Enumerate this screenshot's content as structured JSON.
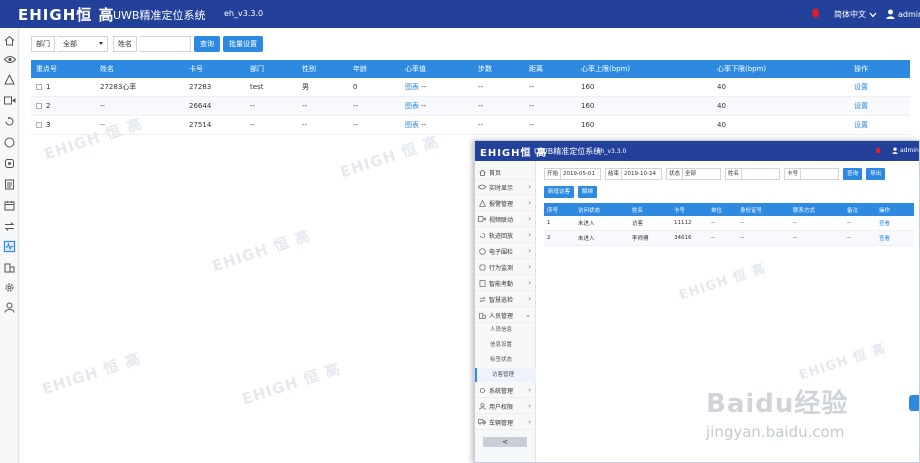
{
  "header": {
    "logo": "EHIGH恒 高",
    "title": "UWB精准定位系统",
    "version": "eh_v3.3.0",
    "language": "简体中文",
    "username": "admin"
  },
  "filters": {
    "dept_label": "部门",
    "dept_value": "全部",
    "name_label": "姓名",
    "name_value": "",
    "query_button": "查询",
    "batch_button": "批量设置"
  },
  "table": {
    "headers": [
      "重点号",
      "姓名",
      "卡号",
      "部门",
      "性别",
      "年龄",
      "心率值",
      "步数",
      "距离",
      "心率上限(bpm)",
      "心率下限(bpm)",
      "操作"
    ],
    "rows": [
      {
        "no": "1",
        "name": "27283心率",
        "card": "27283",
        "dept": "test",
        "sex": "男",
        "age": "0",
        "hr_link": "图表",
        "hr": "--",
        "steps": "--",
        "dist": "--",
        "upper": "160",
        "lower": "40",
        "action": "设置"
      },
      {
        "no": "2",
        "name": "--",
        "card": "26644",
        "dept": "--",
        "sex": "--",
        "age": "--",
        "hr_link": "图表",
        "hr": "--",
        "steps": "--",
        "dist": "--",
        "upper": "160",
        "lower": "40",
        "action": "设置"
      },
      {
        "no": "3",
        "name": "--",
        "card": "27514",
        "dept": "--",
        "sex": "--",
        "age": "--",
        "hr_link": "图表",
        "hr": "--",
        "steps": "--",
        "dist": "--",
        "upper": "160",
        "lower": "40",
        "action": "设置"
      }
    ]
  },
  "watermark": "EHIGH 恒 高",
  "overlay": {
    "logo": "EHIGH恒 高",
    "title": "UWB精准定位系统",
    "version": "eh_v3.3.0",
    "username": "admin",
    "menu": [
      "首页",
      "实时显示",
      "报警管理",
      "视频联动",
      "轨迹回放",
      "电子围栏",
      "行为监测",
      "智能考勤",
      "智慧巡检",
      "人员管理"
    ],
    "submenu": [
      "人员信息",
      "信息设置",
      "标签状态",
      "访客管理"
    ],
    "menu_bottom": [
      "系统管理",
      "用户权限",
      "车辆管理"
    ],
    "collapse": "<",
    "filter": {
      "start_label": "开始",
      "start_value": "2019-05-01",
      "end_label": "结束",
      "end_value": "2019-10-24",
      "status_label": "状态",
      "status_value": "全部",
      "name_label": "姓名",
      "card_label": "卡号",
      "query": "查询",
      "export": "导出",
      "add_visitor": "新增访客",
      "release": "解绑"
    },
    "headers": [
      "序号",
      "访问状态",
      "姓名",
      "卡号",
      "单位",
      "身份证号",
      "联系方式",
      "备注",
      "操作"
    ],
    "rows": [
      {
        "no": "1",
        "status": "未进入",
        "name": "访客",
        "card": "11112",
        "unit": "--",
        "id": "--",
        "phone": "--",
        "note": "--",
        "action": "查看"
      },
      {
        "no": "2",
        "status": "未进入",
        "name": "李师傅",
        "card": "34616",
        "unit": "--",
        "id": "--",
        "phone": "--",
        "note": "--",
        "action": "查看"
      }
    ]
  },
  "baidu": {
    "logo": "Baidu经验",
    "url": "jingyan.baidu.com"
  }
}
